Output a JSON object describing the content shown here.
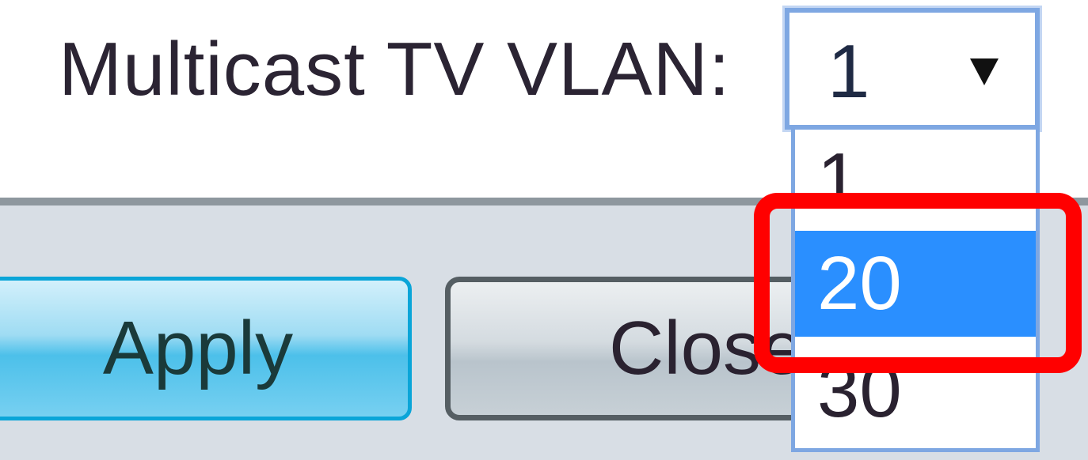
{
  "form": {
    "field_label": "Multicast TV VLAN:",
    "selected_value": "1"
  },
  "dropdown": {
    "options": [
      "1",
      "20",
      "30"
    ],
    "highlighted_option": "20",
    "highlight_color": "#2a8fff"
  },
  "buttons": {
    "apply_label": "Apply",
    "close_label": "Close"
  },
  "annotation": {
    "highlight_color": "#ff0000"
  }
}
